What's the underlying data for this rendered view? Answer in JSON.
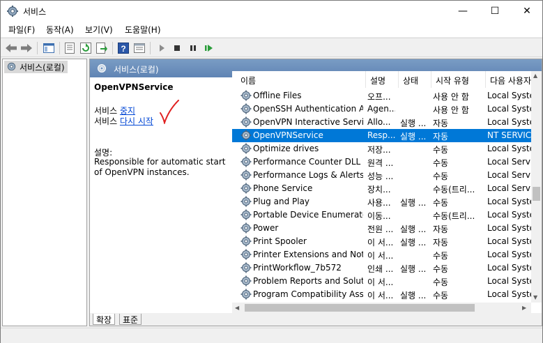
{
  "window": {
    "title": "서비스",
    "minimize_glyph": "—",
    "maximize_glyph": "☐",
    "close_glyph": "✕"
  },
  "menu": [
    "파일(F)",
    "동작(A)",
    "보기(V)",
    "도움말(H)"
  ],
  "toolbar": {
    "icons": [
      "back-icon",
      "forward-icon",
      "show-tree-icon",
      "properties-icon",
      "refresh-icon",
      "export-icon",
      "help-icon",
      "view-icon",
      "start-icon",
      "stop-icon",
      "pause-icon",
      "resume-icon"
    ]
  },
  "tree": {
    "root_label": "서비스(로컬)"
  },
  "main": {
    "header": "서비스(로컬)",
    "selected_service": "OpenVPNService",
    "action_prefix": "서비스",
    "stop_link": "중지",
    "restart_link": "다시 시작",
    "desc_label": "설명:",
    "desc_text": "Responsible for automatic start of OpenVPN instances."
  },
  "columns": [
    "이름",
    "설명",
    "상태",
    "시작 유형",
    "다음 사용자"
  ],
  "rows": [
    {
      "name": "Offline Files",
      "desc": "오프...",
      "status": "",
      "startup": "사용 안 함",
      "logon": "Local System"
    },
    {
      "name": "OpenSSH Authentication A...",
      "desc": "Agen...",
      "status": "",
      "startup": "사용 안 함",
      "logon": "Local System"
    },
    {
      "name": "OpenVPN Interactive Service",
      "desc": "Allo...",
      "status": "실행 ...",
      "startup": "자동",
      "logon": "Local System"
    },
    {
      "name": "OpenVPNService",
      "desc": "Resp...",
      "status": "실행 ...",
      "startup": "자동",
      "logon": "NT SERVICE",
      "selected": true
    },
    {
      "name": "Optimize drives",
      "desc": "저장...",
      "status": "",
      "startup": "수동",
      "logon": "Local System"
    },
    {
      "name": "Performance Counter DLL ...",
      "desc": "원격 ...",
      "status": "",
      "startup": "수동",
      "logon": "Local Service"
    },
    {
      "name": "Performance Logs & Alerts",
      "desc": "성능 ...",
      "status": "",
      "startup": "수동",
      "logon": "Local Service"
    },
    {
      "name": "Phone Service",
      "desc": "장치...",
      "status": "",
      "startup": "수동(트리...",
      "logon": "Local Service"
    },
    {
      "name": "Plug and Play",
      "desc": "사용...",
      "status": "실행 ...",
      "startup": "수동",
      "logon": "Local System"
    },
    {
      "name": "Portable Device Enumerato...",
      "desc": "이동...",
      "status": "",
      "startup": "수동(트리...",
      "logon": "Local System"
    },
    {
      "name": "Power",
      "desc": "전원 ...",
      "status": "실행 ...",
      "startup": "자동",
      "logon": "Local System"
    },
    {
      "name": "Print Spooler",
      "desc": "이 서...",
      "status": "실행 ...",
      "startup": "자동",
      "logon": "Local System"
    },
    {
      "name": "Printer Extensions and Noti...",
      "desc": "이 서...",
      "status": "",
      "startup": "수동",
      "logon": "Local System"
    },
    {
      "name": "PrintWorkflow_7b572",
      "desc": "인쇄 ...",
      "status": "실행 ...",
      "startup": "수동",
      "logon": "Local System"
    },
    {
      "name": "Problem Reports and Solut...",
      "desc": "이 서...",
      "status": "",
      "startup": "수동",
      "logon": "Local System"
    },
    {
      "name": "Program Compatibility Assi...",
      "desc": "이 서...",
      "status": "실행 ...",
      "startup": "수동",
      "logon": "Local System"
    }
  ],
  "tabs": [
    "확장",
    "표준"
  ],
  "colors": {
    "selection": "#0078d7",
    "link": "#0046d5",
    "header": "#6b8fbf",
    "check": "#e02020"
  }
}
